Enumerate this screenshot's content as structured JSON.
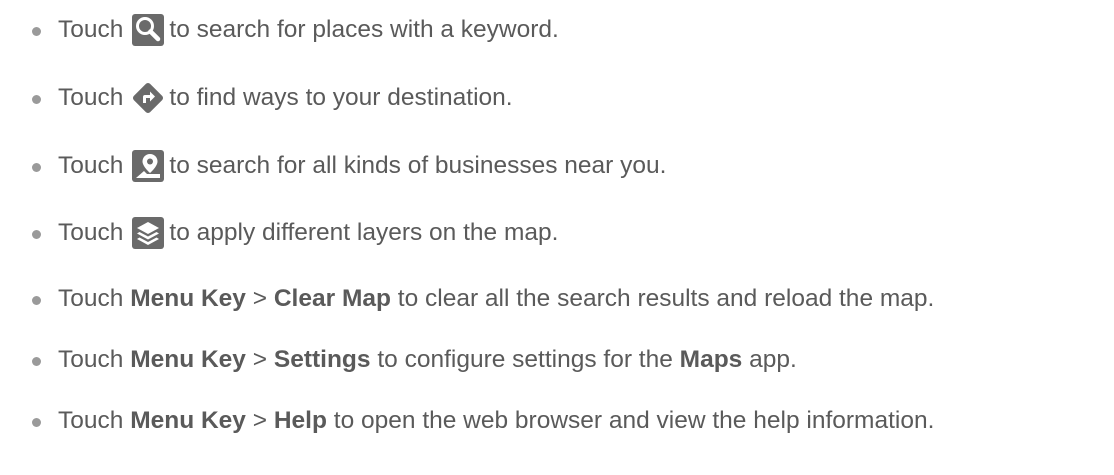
{
  "colors": {
    "text": "#5a5a5a",
    "bullet": "#9a9a9a",
    "icon_bg": "#6a6a6a",
    "icon_fg": "#ffffff"
  },
  "items": [
    {
      "prefix": "Touch",
      "icon": "search-icon",
      "rest": "to search for places with a keyword."
    },
    {
      "prefix": "Touch",
      "icon": "directions-icon",
      "rest": "to find ways to your destination."
    },
    {
      "prefix": "Touch",
      "icon": "places-icon",
      "rest": "to search for all kinds of businesses near you."
    },
    {
      "prefix": "Touch",
      "icon": "layers-icon",
      "rest": "to apply different layers on the map."
    },
    {
      "prefix": "Touch",
      "bold1": "Menu Key",
      "sep": ">",
      "bold2": "Clear Map",
      "rest": "to clear all the search results and reload the map."
    },
    {
      "prefix": "Touch",
      "bold1": "Menu Key",
      "sep": ">",
      "bold2": "Settings",
      "mid": "to configure settings for the",
      "bold3": "Maps",
      "rest": "app."
    },
    {
      "prefix": "Touch",
      "bold1": "Menu Key",
      "sep": ">",
      "bold2": "Help",
      "rest": "to open the web browser and view the help information."
    }
  ]
}
